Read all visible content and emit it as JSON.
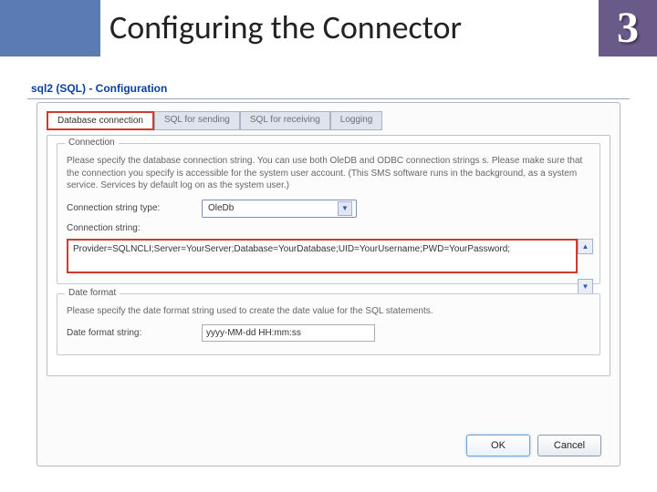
{
  "slide": {
    "title": "Configuring the Connector",
    "badge": "3"
  },
  "window": {
    "title": "sql2 (SQL) - Configuration"
  },
  "tabs": {
    "db": "Database connection",
    "send": "SQL for sending",
    "recv": "SQL for receiving",
    "log": "Logging"
  },
  "groups": {
    "connection": {
      "legend": "Connection",
      "help": "Please specify the database connection string. You can use both OleDB and ODBC connection strings s. Please make sure that the connection you specify is accessible for the system user account. (This SMS software runs in the background, as a system service. Services by default log on as the system user.)",
      "type_label": "Connection string type:",
      "type_value": "OleDb",
      "string_label": "Connection string:",
      "string_value": "Provider=SQLNCLI;Server=YourServer;Database=YourDatabase;UID=YourUsername;PWD=YourPassword;"
    },
    "date": {
      "legend": "Date format",
      "help": "Please specify the date format string used to create the date value for the SQL statements.",
      "label": "Date format string:",
      "value": "yyyy-MM-dd HH:mm:ss"
    }
  },
  "buttons": {
    "ok": "OK",
    "cancel": "Cancel"
  }
}
